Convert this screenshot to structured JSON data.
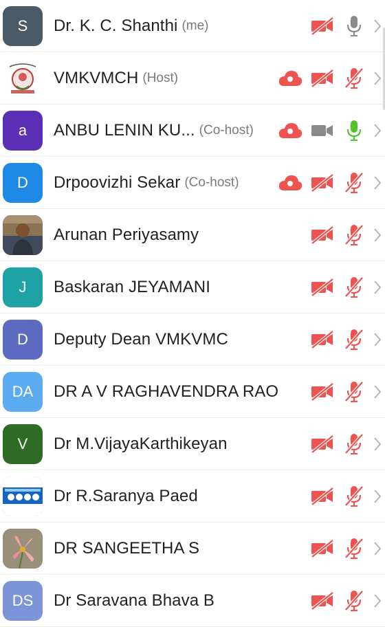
{
  "colors": {
    "red": "#ef5350",
    "gray": "#8a8a8a",
    "green": "#54c22c",
    "chevron": "#b5b5b5"
  },
  "participants": [
    {
      "initial": "S",
      "name": "Dr. K. C. Shanthi",
      "role": "(me)",
      "avatar_color": "#4a5a66",
      "avatar_type": "letter",
      "cloud": false,
      "video": "off",
      "mic": "gray"
    },
    {
      "initial": "",
      "name": "VMKVMCH",
      "role": "(Host)",
      "avatar_color": "#ffffff",
      "avatar_type": "logo-emblem",
      "cloud": true,
      "video": "off",
      "mic": "muted"
    },
    {
      "initial": "a",
      "name": "ANBU LENIN KU...",
      "role": "(Co-host)",
      "avatar_color": "#5a2fb4",
      "avatar_type": "letter",
      "cloud": true,
      "video": "gray",
      "mic": "green"
    },
    {
      "initial": "D",
      "name": "Drpoovizhi Sekar",
      "role": "(Co-host)",
      "avatar_color": "#1e88e5",
      "avatar_type": "letter",
      "cloud": true,
      "video": "off",
      "mic": "muted"
    },
    {
      "initial": "",
      "name": "Arunan Periyasamy",
      "role": "",
      "avatar_color": "#6b5a3f",
      "avatar_type": "photo-person",
      "cloud": false,
      "video": "off",
      "mic": "muted"
    },
    {
      "initial": "J",
      "name": "Baskaran JEYAMANI",
      "role": "",
      "avatar_color": "#1fa2a6",
      "avatar_type": "letter",
      "cloud": false,
      "video": "off",
      "mic": "muted"
    },
    {
      "initial": "D",
      "name": "Deputy Dean VMKVMC",
      "role": "",
      "avatar_color": "#5c6bc0",
      "avatar_type": "letter",
      "cloud": false,
      "video": "off",
      "mic": "muted"
    },
    {
      "initial": "DA",
      "name": "DR A V RAGHAVENDRA RAO",
      "role": "",
      "avatar_color": "#5aabf0",
      "avatar_type": "letter",
      "cloud": false,
      "video": "off",
      "mic": "muted"
    },
    {
      "initial": "V",
      "name": "Dr M.VijayaKarthikeyan",
      "role": "",
      "avatar_color": "#2e6b24",
      "avatar_type": "letter",
      "cloud": false,
      "video": "off",
      "mic": "muted"
    },
    {
      "initial": "",
      "name": "Dr R.Saranya Paed",
      "role": "",
      "avatar_color": "#1976d2",
      "avatar_type": "photo-banner",
      "cloud": false,
      "video": "off",
      "mic": "muted"
    },
    {
      "initial": "",
      "name": "DR SANGEETHA S",
      "role": "",
      "avatar_color": "#8a8a70",
      "avatar_type": "photo-flower",
      "cloud": false,
      "video": "off",
      "mic": "muted"
    },
    {
      "initial": "DS",
      "name": "Dr Saravana Bhava B",
      "role": "",
      "avatar_color": "#7b95d8",
      "avatar_type": "letter",
      "cloud": false,
      "video": "off",
      "mic": "muted"
    }
  ]
}
